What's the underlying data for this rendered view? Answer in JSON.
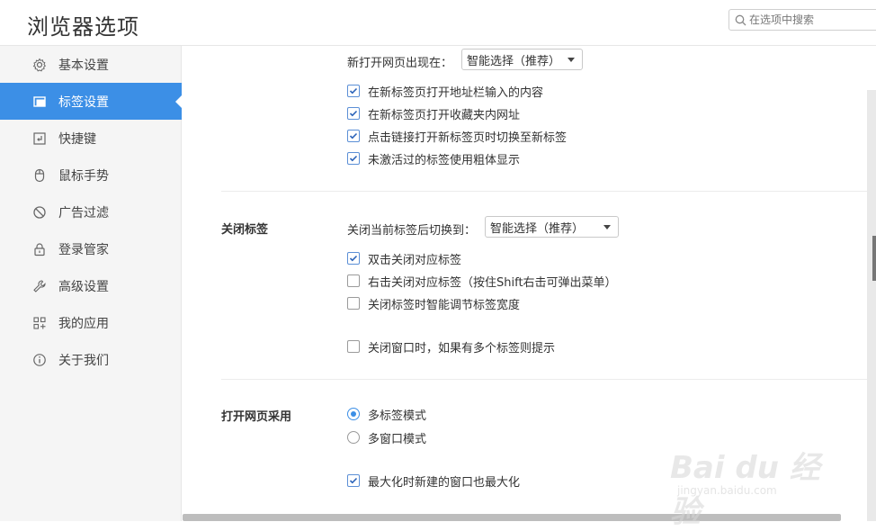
{
  "header": {
    "title": "浏览器选项",
    "search_placeholder": "在选项中搜索"
  },
  "sidebar": {
    "items": [
      {
        "label": "基本设置",
        "icon": "gear-icon"
      },
      {
        "label": "标签设置",
        "icon": "tab-icon",
        "active": true
      },
      {
        "label": "快捷键",
        "icon": "shortcut-icon"
      },
      {
        "label": "鼠标手势",
        "icon": "mouse-icon"
      },
      {
        "label": "广告过滤",
        "icon": "block-icon"
      },
      {
        "label": "登录管家",
        "icon": "lock-icon"
      },
      {
        "label": "高级设置",
        "icon": "wrench-icon"
      },
      {
        "label": "我的应用",
        "icon": "apps-icon"
      },
      {
        "label": "关于我们",
        "icon": "info-icon"
      }
    ]
  },
  "main": {
    "new_tab": {
      "label": "新打开网页出现在：",
      "select_value": "智能选择（推荐）",
      "options": [
        {
          "label": "在新标签页打开地址栏输入的内容",
          "checked": true
        },
        {
          "label": "在新标签页打开收藏夹内网址",
          "checked": true
        },
        {
          "label": "点击链接打开新标签页时切换至新标签",
          "checked": true
        },
        {
          "label": "未激活过的标签使用粗体显示",
          "checked": true
        }
      ]
    },
    "close_tab": {
      "section": "关闭标签",
      "label": "关闭当前标签后切换到：",
      "select_value": "智能选择（推荐）",
      "options": [
        {
          "label": "双击关闭对应标签",
          "checked": true
        },
        {
          "label": "右击关闭对应标签（按住Shift右击可弹出菜单）",
          "checked": false
        },
        {
          "label": "关闭标签时智能调节标签宽度",
          "checked": false
        },
        {
          "label": "关闭窗口时，如果有多个标签则提示",
          "checked": false
        }
      ]
    },
    "open_mode": {
      "section": "打开网页采用",
      "radios": [
        {
          "label": "多标签模式",
          "checked": true
        },
        {
          "label": "多窗口模式",
          "checked": false
        }
      ],
      "options": [
        {
          "label": "最大化时新建的窗口也最大化",
          "checked": true
        }
      ]
    }
  },
  "watermark": {
    "text": "Bai du 经验",
    "sub": "jingyan.baidu.com"
  },
  "colors": {
    "accent": "#3c8fe6",
    "sidebar_bg": "#f5f5f5"
  }
}
